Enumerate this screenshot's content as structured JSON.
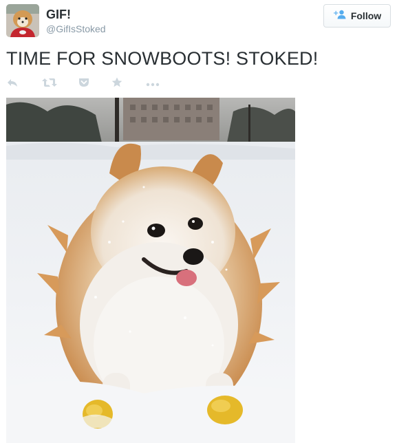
{
  "user": {
    "display_name": "GIF!",
    "screen_name": "@GifIsStoked"
  },
  "follow_button": {
    "label": "Follow",
    "icon": "follow-user-plus-icon"
  },
  "tweet": {
    "text": "TIME FOR SNOWBOOTS! STOKED!"
  },
  "actions": [
    {
      "name": "reply",
      "icon": "reply-icon"
    },
    {
      "name": "retweet",
      "icon": "retweet-icon"
    },
    {
      "name": "pocket",
      "icon": "pocket-icon"
    },
    {
      "name": "favorite",
      "icon": "star-icon"
    },
    {
      "name": "more",
      "icon": "more-dots-icon"
    }
  ],
  "colors": {
    "text": "#292f33",
    "muted": "#8899a6",
    "icon": "#ccd6dd",
    "follow_accent": "#55acee"
  }
}
